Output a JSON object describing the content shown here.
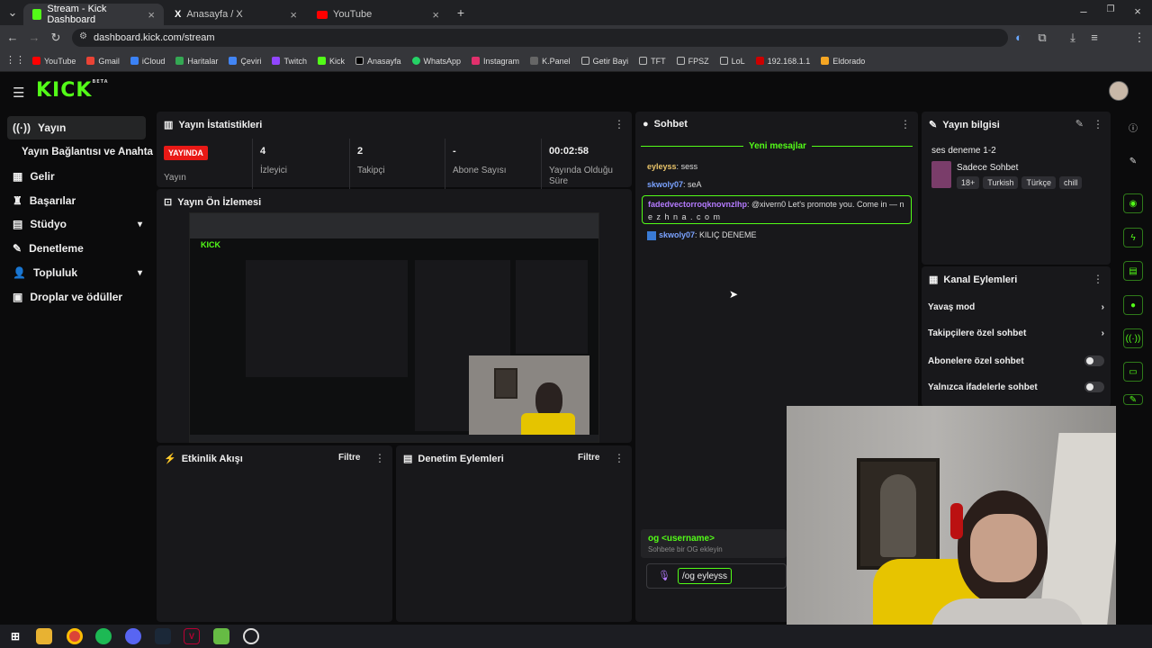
{
  "browser": {
    "tabs": [
      {
        "label": "Stream - Kick Dashboard"
      },
      {
        "label": "Anasayfa / X"
      },
      {
        "label": "YouTube"
      }
    ],
    "url": "dashboard.kick.com/stream",
    "bookmarks": [
      "YouTube",
      "Gmail",
      "iCloud",
      "Haritalar",
      "Çeviri",
      "Twitch",
      "Kick",
      "Anasayfa",
      "WhatsApp",
      "Instagram",
      "K.Panel",
      "Getir Bayi",
      "TFT",
      "FPSZ",
      "LoL",
      "192.168.1.1",
      "Eldorado"
    ]
  },
  "app": {
    "logo": "KICK",
    "logo_badge": "BETA"
  },
  "sidebar": {
    "items": [
      {
        "label": "Yayın"
      },
      {
        "label": "Yayın Bağlantısı ve Anahtarı"
      },
      {
        "label": "Gelir"
      },
      {
        "label": "Başarılar"
      },
      {
        "label": "Stüdyo"
      },
      {
        "label": "Denetleme"
      },
      {
        "label": "Topluluk"
      },
      {
        "label": "Droplar ve ödüller"
      }
    ]
  },
  "stats": {
    "title": "Yayın İstatistikleri",
    "live_badge": "YAYINDA",
    "items": [
      {
        "value": "",
        "label": "Yayın"
      },
      {
        "value": "4",
        "label": "İzleyici"
      },
      {
        "value": "2",
        "label": "Takipçi"
      },
      {
        "value": "-",
        "label": "Abone Sayısı"
      },
      {
        "value": "00:02:58",
        "label": "Yayında Olduğu Süre"
      }
    ]
  },
  "preview": {
    "title": "Yayın Ön İzlemesi"
  },
  "activity": {
    "title": "Etkinlik Akışı",
    "filter": "Filtre"
  },
  "moderation": {
    "title": "Denetim Eylemleri",
    "filter": "Filtre"
  },
  "chat": {
    "title": "Sohbet",
    "new_messages": "Yeni mesajlar",
    "messages": [
      {
        "user": "eyleyss",
        "text": "sess"
      },
      {
        "user": "skwoly07",
        "text": "seA"
      },
      {
        "user": "fadedvectorroqknovnzlhp",
        "text": "@xivern0 Let's promote you. Come in — n",
        "text2": "e z h n a . c o m"
      },
      {
        "user": "skwoly07",
        "text": "KILIÇ DENEME"
      }
    ],
    "suggestion_cmd": "og <username>",
    "suggestion_hint": "Sohbete bir OG ekleyin",
    "input_value": "/og eyleyss"
  },
  "stream_info": {
    "title": "Yayın bilgisi",
    "stream_title": "ses deneme 1-2",
    "category": "Sadece Sohbet",
    "tags": [
      "18+",
      "Turkish",
      "Türkçe",
      "chill"
    ]
  },
  "channel_actions": {
    "title": "Kanal Eylemleri",
    "items": [
      {
        "label": "Yavaş mod",
        "control": "arrow"
      },
      {
        "label": "Takipçilere özel sohbet",
        "control": "arrow"
      },
      {
        "label": "Abonelere özel sohbet",
        "control": "toggle"
      },
      {
        "label": "Yalnızca ifadelerle sohbet",
        "control": "toggle"
      }
    ]
  },
  "colors": {
    "accent": "#53fc18",
    "live": "#e91916",
    "panel": "#18181b",
    "bg": "#0b0b0c"
  }
}
